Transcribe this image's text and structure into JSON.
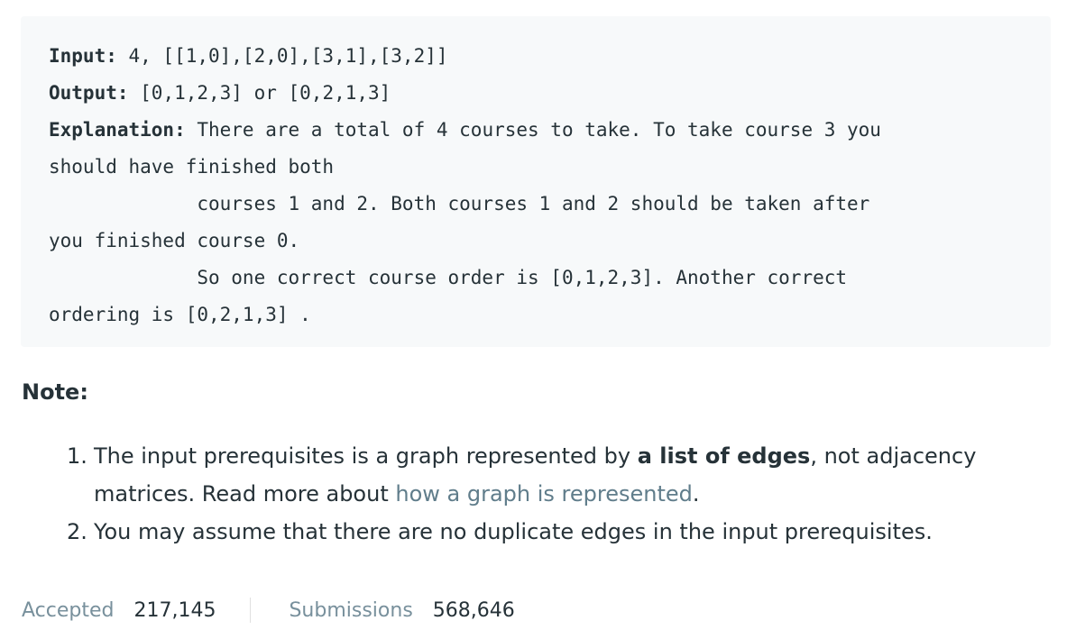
{
  "example": {
    "input_label": "Input:",
    "input_value": " 4, [[1,0],[2,0],[3,1],[3,2]]",
    "output_label": "Output:",
    "output_value": " [0,1,2,3] or [0,2,1,3]",
    "explanation_label": "Explanation:",
    "explanation_lines": [
      " There are a total of 4 courses to take. To take course 3 you",
      "should have finished both",
      "             courses 1 and 2. Both courses 1 and 2 should be taken after",
      "you finished course 0.",
      "             So one correct course order is [0,1,2,3]. Another correct",
      "ordering is [0,2,1,3] ."
    ]
  },
  "note": {
    "heading": "Note:",
    "items": [
      {
        "number": "1.",
        "text_before": "The input prerequisites is a graph represented by ",
        "bold": "a list of edges",
        "text_middle": ", not adjacency matrices. Read more about ",
        "link": "how a graph is represented",
        "text_after": "."
      },
      {
        "number": "2.",
        "text": "You may assume that there are no duplicate edges in the input prerequisites."
      }
    ]
  },
  "stats": {
    "accepted_label": "Accepted",
    "accepted_value": "217,145",
    "submissions_label": "Submissions",
    "submissions_value": "568,646"
  },
  "colors": {
    "text": "#263238",
    "muted": "#78909c",
    "link": "#607d8b",
    "code_background": "#f7f9fa"
  }
}
